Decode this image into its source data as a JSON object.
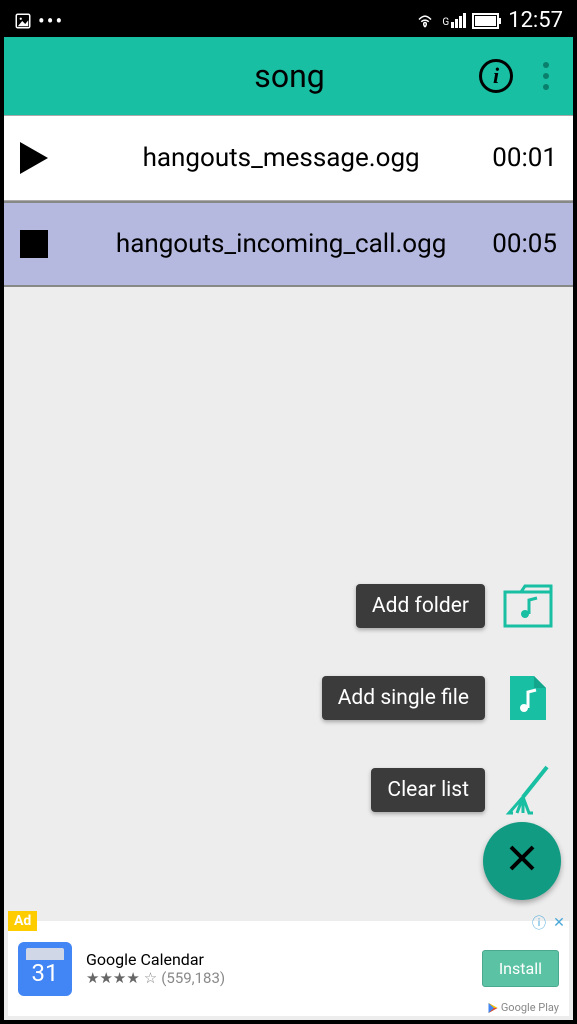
{
  "status": {
    "time": "12:57",
    "signal_label": "G"
  },
  "appbar": {
    "title": "song"
  },
  "tracks": [
    {
      "name": "hangouts_message.ogg",
      "duration": "00:01",
      "playing": false
    },
    {
      "name": "hangouts_incoming_call.ogg",
      "duration": "00:05",
      "playing": true
    }
  ],
  "fab": {
    "add_folder": "Add folder",
    "add_file": "Add single file",
    "clear": "Clear list"
  },
  "ad": {
    "badge": "Ad",
    "title": "Google Calendar",
    "ratings": "(559,183)",
    "install": "Install",
    "store": "Google Play",
    "day": "31"
  }
}
